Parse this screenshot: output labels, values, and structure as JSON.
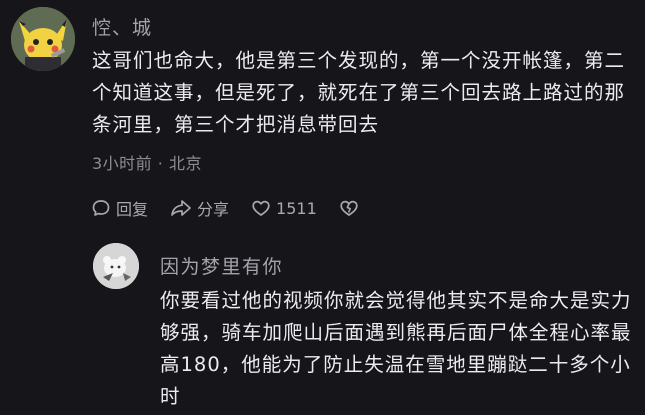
{
  "comment": {
    "username": "悾、城",
    "text": "这哥们也命大，他是第三个发现的，第一个没开帐篷，第二个知道这事，但是死了，就死在了第三个回去路上路过的那条河里，第三个才把消息带回去",
    "meta": "3小时前 · 北京",
    "reply_label": "回复",
    "share_label": "分享",
    "like_count": "1511",
    "icons": [
      "reply-icon",
      "share-icon",
      "like-icon",
      "dislike-icon"
    ]
  },
  "reply": {
    "username": "因为梦里有你",
    "text": "你要看过他的视频你就会觉得他其实不是命大是实力够强，骑车加爬山后面遇到熊再后面尸体全程心率最高180，他能为了防止失温在雪地里蹦跶二十多个小时"
  }
}
